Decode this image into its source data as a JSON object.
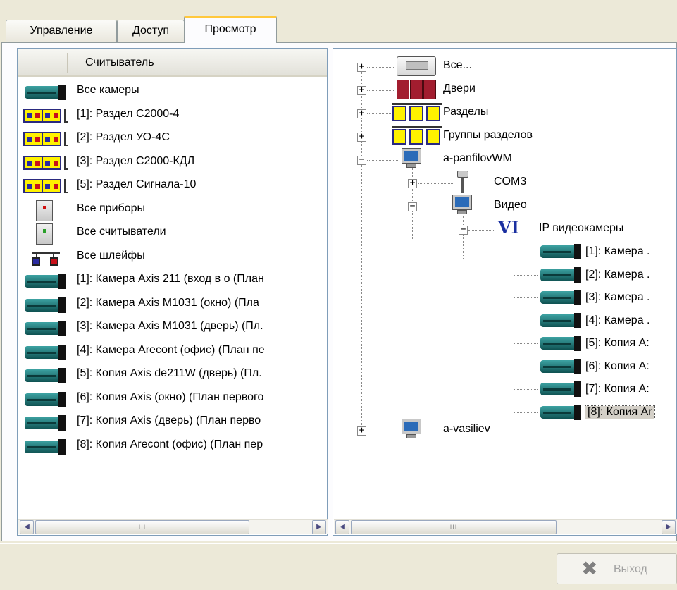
{
  "tabs": [
    {
      "label": "Управление",
      "active": false
    },
    {
      "label": "Доступ",
      "active": false
    },
    {
      "label": "Просмотр",
      "active": true
    }
  ],
  "left_panel": {
    "column_header": "Считыватель",
    "items": [
      {
        "icon": "camera-icon",
        "label": "Все камеры"
      },
      {
        "icon": "partition-icon",
        "label": "[1]: Раздел С2000-4"
      },
      {
        "icon": "partition-icon",
        "label": "[2]: Раздел УО-4С"
      },
      {
        "icon": "partition-icon",
        "label": "[3]: Раздел С2000-КДЛ"
      },
      {
        "icon": "partition-icon",
        "label": "[5]: Раздел Сигнала-10"
      },
      {
        "icon": "device-icon",
        "label": "Все приборы"
      },
      {
        "icon": "reader-icon",
        "label": "Все считыватели"
      },
      {
        "icon": "loops-icon",
        "label": "Все шлейфы"
      },
      {
        "icon": "camera-icon",
        "label": "[1]: Камера Axis 211 (вход в о (План"
      },
      {
        "icon": "camera-icon",
        "label": "[2]: Камера Axis M1031 (окно) (Пла"
      },
      {
        "icon": "camera-icon",
        "label": "[3]: Камера Axis M1031 (дверь) (Пл."
      },
      {
        "icon": "camera-icon",
        "label": "[4]: Камера Arecont (офис) (План пе"
      },
      {
        "icon": "camera-icon",
        "label": "[5]: Копия Axis de211W (дверь) (Пл."
      },
      {
        "icon": "camera-icon",
        "label": "[6]: Копия Axis (окно) (План первого"
      },
      {
        "icon": "camera-icon",
        "label": "[7]: Копия Axis (дверь) (План перво"
      },
      {
        "icon": "camera-icon",
        "label": "[8]: Копия Arecont (офис) (План пер"
      }
    ]
  },
  "tree": {
    "root_nodes": [
      {
        "icon": "control-panel-icon",
        "label": "Все...",
        "expander": "+"
      },
      {
        "icon": "doors-icon",
        "label": "Двери",
        "expander": "+"
      },
      {
        "icon": "partitions-icon",
        "label": "Разделы",
        "expander": "+"
      },
      {
        "icon": "partition-groups-icon",
        "label": "Группы разделов",
        "expander": "+"
      },
      {
        "icon": "computer-icon",
        "label": "a-panfilovWM",
        "expander": "−"
      }
    ],
    "computer_children": [
      {
        "icon": "com-port-icon",
        "label": "COM3",
        "expander": "+"
      },
      {
        "icon": "computer-icon",
        "label": "Видео",
        "expander": "−"
      }
    ],
    "video_child": {
      "icon_text": "VI",
      "label": "IP видеокамеры",
      "expander": "−"
    },
    "cameras": [
      {
        "label": "[1]: Камера ."
      },
      {
        "label": "[2]: Камера ."
      },
      {
        "label": "[3]: Камера ."
      },
      {
        "label": "[4]: Камера ."
      },
      {
        "label": "[5]: Копия А:"
      },
      {
        "label": "[6]: Копия А:"
      },
      {
        "label": "[7]: Копия А:"
      },
      {
        "label": "[8]: Копия Ar",
        "selected": true
      }
    ],
    "last_root": {
      "icon": "computer-icon",
      "label": "a-vasiliev",
      "expander": "+"
    }
  },
  "scrollbars": {
    "left": {
      "thumb_grip": "III"
    },
    "right": {
      "thumb_grip": "III"
    }
  },
  "footer": {
    "exit_label": "Выход",
    "exit_enabled": false
  },
  "colors": {
    "active_tab_accent": "#ffc83c",
    "selection": "#d4d0c8",
    "window_bg": "#ece9d8"
  }
}
